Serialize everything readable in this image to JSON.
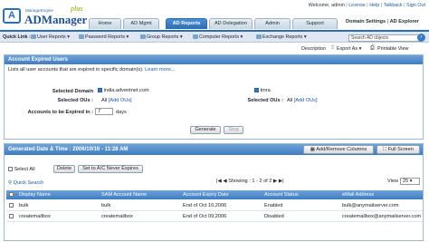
{
  "brand": {
    "sub": "ManageEngine",
    "name": "ADManager",
    "plus": "plus"
  },
  "toplinks": {
    "welcome": "Welcome, admin",
    "license": "License",
    "help": "Help",
    "talkback": "Talkback",
    "signout": "Sign Out"
  },
  "tabs": [
    "Home",
    "AD Mgmt",
    "AD Reports",
    "AD Delegation",
    "Admin",
    "Support"
  ],
  "domainbar": {
    "settings": "Domain Settings",
    "explorer": "AD Explorer"
  },
  "nav": {
    "quicklink": "Quick Link :",
    "items": [
      "User Reports",
      "Password Reports",
      "Group Reports",
      "Computer Reports",
      "Exchange Reports"
    ],
    "search_placeholder": "Search AD objects"
  },
  "actions": {
    "description": "Description",
    "export": "Export As",
    "printable": "Printable View"
  },
  "panel1": {
    "title": "Account Expired Users",
    "intro": "Lists all user accounts that are expired in specific domain(s).",
    "learn": "Learn more...",
    "domain_label": "Selected Domain",
    "ous_label": "Selected OUs :",
    "days_label": "Accounts to be Expired in :",
    "days_value": "7",
    "days_unit": "days",
    "domain1": "india.adventnet.com",
    "domain2": "tmra",
    "ous_all": "All",
    "add_ous": "[Add OUs]",
    "generate": "Generate",
    "stop": "Stop"
  },
  "panel2": {
    "title": "Generated Date & Time : 2006/10/16 - 11:28 AM",
    "addremove": "Add/Remove Columns",
    "fullscreen": "Full Screen",
    "selectall": "Select All",
    "delete": "Delete",
    "never": "Set to A/C Never Expires",
    "quicksearch": "Quick Search",
    "showing": "Showing : 1 - 2 of 2",
    "view_label": "View",
    "view_value": "25",
    "columns": [
      "Display Name",
      "SAM Account Name",
      "Account Expiry Date",
      "Account Status",
      "eMail Address"
    ],
    "rows": [
      [
        "bulk",
        "bulk",
        "End of Oct 10,2006",
        "Enabled",
        "bulk@anymailserver.com"
      ],
      [
        "createmailbox",
        "createmailbox",
        "End of Oct 09,2006",
        "Disabled",
        "createmailbox@anymailserver.com"
      ]
    ]
  }
}
